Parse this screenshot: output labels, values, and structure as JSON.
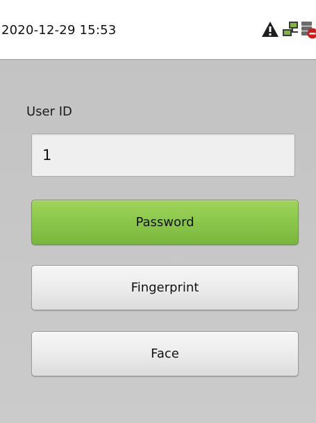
{
  "status_bar": {
    "datetime": "2020-12-29 15:53",
    "icons": [
      "warning-icon",
      "network-icon",
      "server-offline-icon"
    ]
  },
  "form": {
    "user_id_label": "User ID",
    "user_id_value": "1"
  },
  "buttons": {
    "password": "Password",
    "fingerprint": "Fingerprint",
    "face": "Face"
  },
  "colors": {
    "primary_button": "#8cc84c",
    "secondary_button": "#ececec",
    "background": "#c6c6c6",
    "status_bar": "#ffffff"
  }
}
